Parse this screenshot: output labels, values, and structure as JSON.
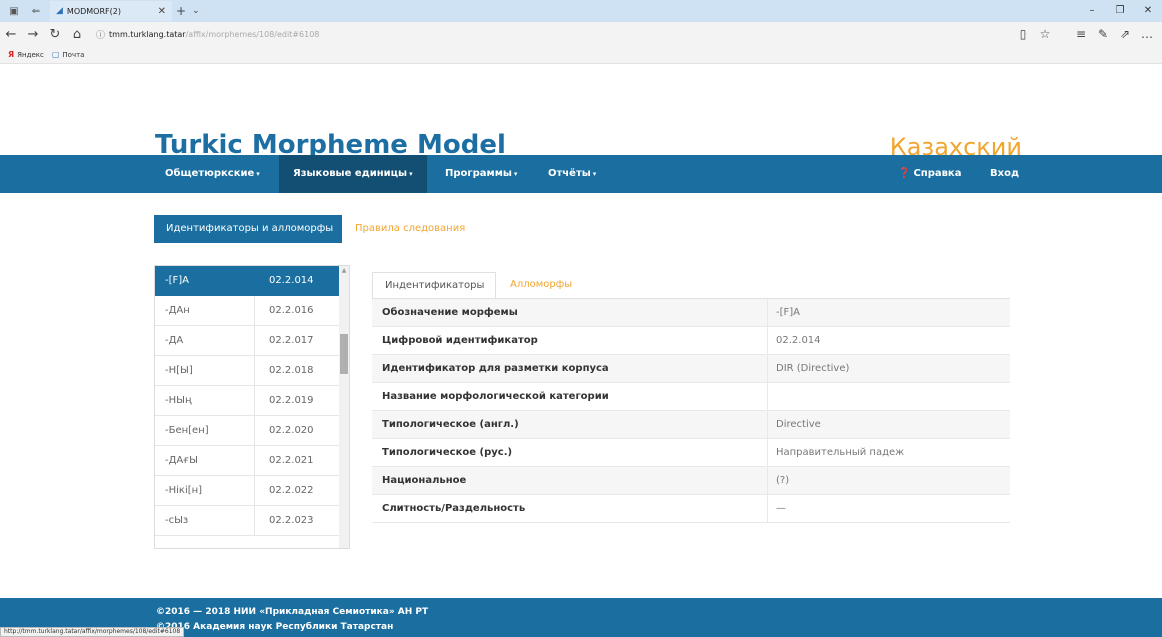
{
  "browser": {
    "tab_title": "MODMORF(2)",
    "url_host": "tmm.turklang.tatar",
    "url_path": "/affix/morphemes/108/edit#6108",
    "bookmarks": [
      "Яндекс",
      "Почта"
    ],
    "status_url": "http://tmm.turklang.tatar/affix/morphemes/108/edit#6108"
  },
  "site": {
    "title": "Turkic Morpheme Model",
    "language": "Казахский"
  },
  "nav": {
    "items": [
      {
        "label": "Общетюркские"
      },
      {
        "label": "Языковые единицы"
      },
      {
        "label": "Программы"
      },
      {
        "label": "Отчёты"
      }
    ],
    "help": "Справка",
    "login": "Вход"
  },
  "pills": {
    "active": "Идентификаторы и алломорфы",
    "link": "Правила следования"
  },
  "list": {
    "rows": [
      {
        "morpheme": "-[F]A",
        "id": "02.2.014"
      },
      {
        "morpheme": "-ДАн",
        "id": "02.2.016"
      },
      {
        "morpheme": "-ДА",
        "id": "02.2.017"
      },
      {
        "morpheme": "-Н[Ы]",
        "id": "02.2.018"
      },
      {
        "morpheme": "-НЫң",
        "id": "02.2.019"
      },
      {
        "morpheme": "-Бен[ен]",
        "id": "02.2.020"
      },
      {
        "morpheme": "-ДАғЫ",
        "id": "02.2.021"
      },
      {
        "morpheme": "-Нікі[н]",
        "id": "02.2.022"
      },
      {
        "morpheme": "-сЫз",
        "id": "02.2.023"
      }
    ]
  },
  "panel": {
    "tab_active": "Индентификаторы",
    "tab_link": "Алломорфы",
    "rows": [
      {
        "label": "Обозначение морфемы",
        "value": "-[F]A"
      },
      {
        "label": "Цифровой идентификатор",
        "value": "02.2.014"
      },
      {
        "label": "Идентификатор для разметки корпуса",
        "value": "DIR (Directive)"
      },
      {
        "label": "Название морфологической категории",
        "value": ""
      },
      {
        "label": "Типологическое (англ.)",
        "value": "Directive"
      },
      {
        "label": "Типологическое (рус.)",
        "value": "Направительный падеж"
      },
      {
        "label": "Национальное",
        "value": "(?)"
      },
      {
        "label": "Слитность/Раздельность",
        "value": "—"
      }
    ]
  },
  "footer": {
    "line1": "©2016 — 2018 НИИ «Прикладная Семиотика» АН РТ",
    "line2": "©2016 Академия наук Республики Татарстан"
  }
}
